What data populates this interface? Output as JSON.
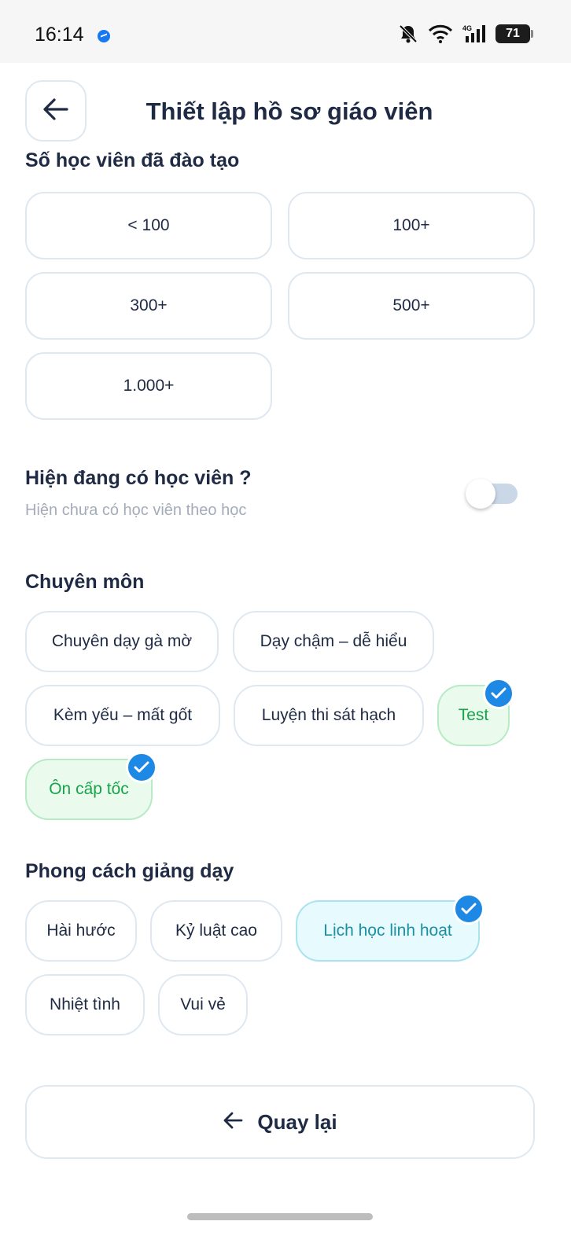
{
  "status_bar": {
    "time": "16:14",
    "battery": "71"
  },
  "header": {
    "title": "Thiết lập hồ sơ giáo viên"
  },
  "students_trained": {
    "label": "Số học viên đã đào tạo",
    "options": [
      "< 100",
      "100+",
      "300+",
      "500+",
      "1.000+"
    ]
  },
  "has_students": {
    "title": "Hiện đang có học viên ?",
    "subtitle": "Hiện chưa có học viên theo học",
    "enabled": false
  },
  "specialty": {
    "title": "Chuyên môn",
    "chips": [
      {
        "label": "Chuyên dạy gà mờ",
        "selected": false
      },
      {
        "label": "Dạy chậm – dễ hiểu",
        "selected": false
      },
      {
        "label": "Kèm yếu – mất gốt",
        "selected": false
      },
      {
        "label": "Luyện thi sát hạch",
        "selected": false
      },
      {
        "label": "Test",
        "selected": true
      },
      {
        "label": "Ôn cấp tốc",
        "selected": true
      }
    ]
  },
  "teaching_style": {
    "title": "Phong cách giảng dạy",
    "chips": [
      {
        "label": "Hài hước",
        "selected": false
      },
      {
        "label": "Kỷ luật cao",
        "selected": false
      },
      {
        "label": "Lịch học linh hoạt",
        "selected": true
      },
      {
        "label": "Nhiệt tình",
        "selected": false
      },
      {
        "label": "Vui vẻ",
        "selected": false
      }
    ]
  },
  "footer": {
    "back_label": "Quay lại"
  },
  "colors": {
    "accent_blue": "#1e88e5",
    "selected_green": "#18a34a",
    "selected_cyan": "#1a8fa6"
  }
}
